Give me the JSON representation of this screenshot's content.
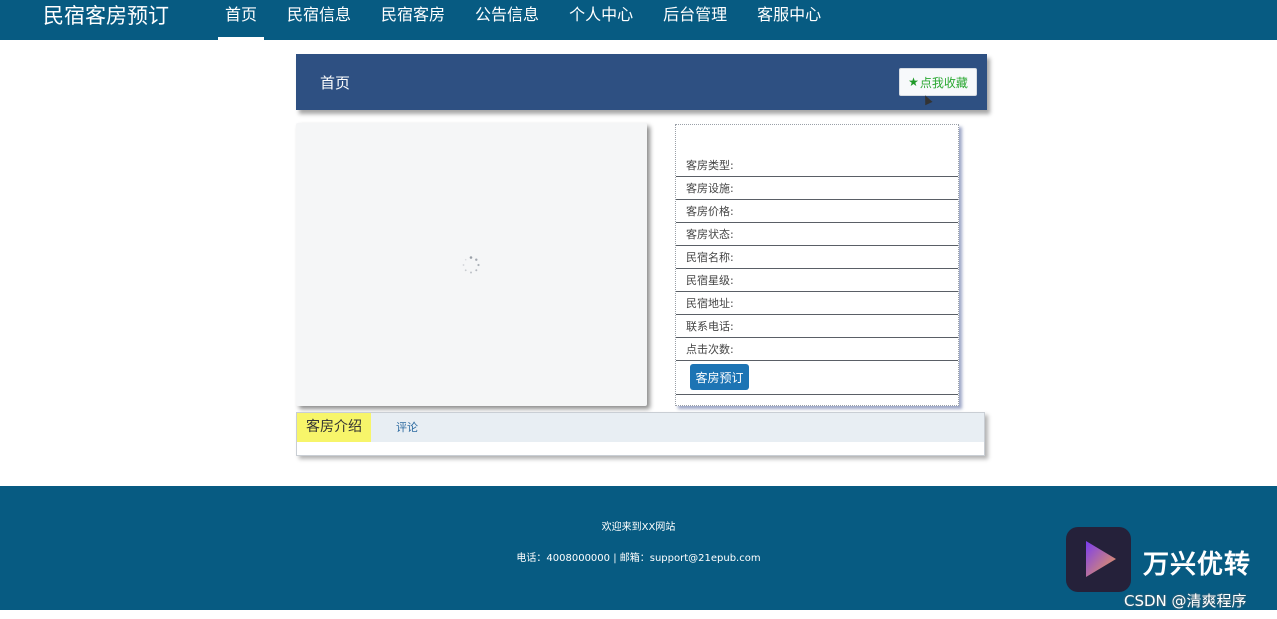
{
  "brand": "民宿客房预订",
  "nav": [
    {
      "label": "首页",
      "active": true
    },
    {
      "label": "民宿信息",
      "active": false
    },
    {
      "label": "民宿客房",
      "active": false
    },
    {
      "label": "公告信息",
      "active": false
    },
    {
      "label": "个人中心",
      "active": false
    },
    {
      "label": "后台管理",
      "active": false
    },
    {
      "label": "客服中心",
      "active": false
    }
  ],
  "header": {
    "title": "首页",
    "favorite_label": "点我收藏",
    "favorite_icon": "star-icon"
  },
  "info": {
    "fields": [
      "客房类型:",
      "客房设施:",
      "客房价格:",
      "客房状态:",
      "民宿名称:",
      "民宿星级:",
      "民宿地址:",
      "联系电话:",
      "点击次数:"
    ],
    "book_label": "客房预订"
  },
  "tabs": {
    "active": "客房介绍",
    "other": "评论"
  },
  "footer": {
    "welcome": "欢迎来到XX网站",
    "contact": "电话：4008000000 | 邮箱：support@21epub.com"
  },
  "watermark": {
    "brand_text": "万兴优转",
    "csdn": "CSDN @清爽程序"
  },
  "colors": {
    "nav_bg": "#075b82",
    "header_bg": "#2e5082",
    "favorite_text": "#2aa832",
    "book_btn": "#1d74b4",
    "tab_active": "#f7f56a",
    "footer_bg": "#075b82"
  }
}
